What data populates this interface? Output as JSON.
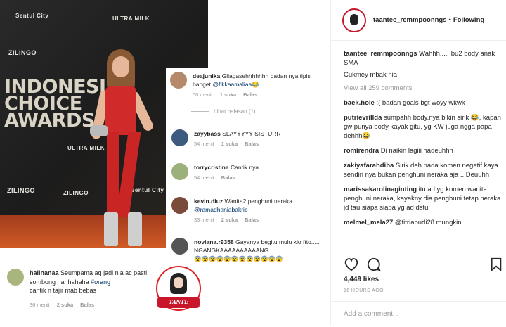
{
  "photo": {
    "event_lines": [
      "INDONESIAN",
      "CHOICE",
      "AWARDS"
    ],
    "sponsors": [
      "Sentul City",
      "ULTRA MILK",
      "ZILINGO",
      "ZILINGO",
      "ULTRA MILK",
      "ZILINGO",
      "Sentul City"
    ]
  },
  "overlay_comments": [
    {
      "user": "deajunika",
      "text": "Gilagasehhhhhhh badan nya tipis banget ",
      "mention": "@fikkaamaliaa",
      "emoji": "😂",
      "time": "50 menit",
      "likes": "1 suka",
      "reply": "Balas"
    },
    {
      "user": "zayybass",
      "text": "SLAYYYYY SISTURR",
      "mention": "",
      "emoji": "",
      "time": "54 menit",
      "likes": "1 suka",
      "reply": "Balas"
    },
    {
      "user": "torrycristina",
      "text": "Cantik nya",
      "mention": "",
      "emoji": "",
      "time": "54 menit",
      "likes": "",
      "reply": "Balas"
    },
    {
      "user": "kevin.diuz",
      "text": "Wanita2 penghuni neraka ",
      "mention": "@ramadhaniabakrie",
      "emoji": "",
      "time": "33 menit",
      "likes": "2 suka",
      "reply": "Balas"
    },
    {
      "user": "noviana.r9358",
      "text": "Gayanya begitu mulu klo ftto..... NGANGKAAAAAAAAAANG",
      "mention": "",
      "emoji": "😨😨😨😨😨😨😨😨😨😨😨😨",
      "time": "",
      "likes": "",
      "reply": ""
    },
    {
      "user": "haiinanaa",
      "text": "Seumpama aq jadi nia ac pasti sombong hahhahaha ",
      "mention": "#orang",
      "extra": "cantik n tajir mab bebas",
      "emoji": "",
      "time": "36 menit",
      "likes": "2 suka",
      "reply": "Balas"
    }
  ],
  "see_replies": "Lihat balasan (1)",
  "stamp_text": "TANTE",
  "header": {
    "username": "taantee_remmpoonngs",
    "dot": "•",
    "follow": "Following"
  },
  "caption": {
    "user": "taantee_remmpoonngs",
    "line1": " Wahhh.... Ibu2 body anak SMA",
    "line2": "Cukmey mbak nia"
  },
  "view_all": "View all 259 comments",
  "comments": [
    {
      "user": "baek.hole",
      "text": " :( badan goals bgt woyy wkwk"
    },
    {
      "user": "putrievrillda",
      "text": " sumpahh body.nya bikin sirik 😂, kapan gw punya body kayak gitu, yg KW juga ngga papa dehhh😂"
    },
    {
      "user": "romirendra",
      "text": " Di naikin lagiii hadeuhhh"
    },
    {
      "user": "zakiyafarahdiba",
      "text": " Sirik deh pada komen negatif kaya sendiri nya bukan penghuni neraka aja .. Deuuhh"
    },
    {
      "user": "marissakarolinaginting",
      "text": " itu ad yg komen wanita penghuni neraka, kayakny dia penghuni tetap neraka jd tau siapa siapa yg ad dstu"
    },
    {
      "user": "melmel_mela27",
      "text": " @fitriabudi28 mungkin"
    }
  ],
  "likes": "4,449 likes",
  "time": "16 HOURS AGO",
  "add_comment_placeholder": "Add a comment...",
  "icons": [
    "heart-icon",
    "comment-icon",
    "bookmark-icon"
  ],
  "colors": {
    "brand_red": "#c8172b",
    "link": "#003569",
    "muted": "#999999"
  }
}
